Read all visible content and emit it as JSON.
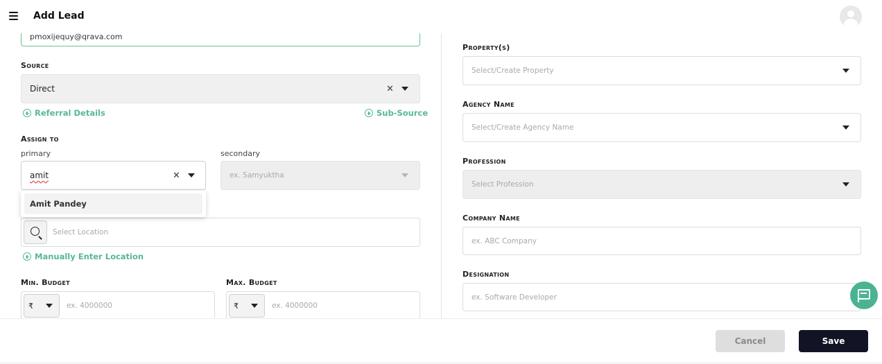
{
  "header": {
    "title": "Add Lead"
  },
  "left": {
    "email_value": "pmoxijequy@qrava.com",
    "source": {
      "label": "Source",
      "value": "Direct"
    },
    "referral_link": "Referral Details",
    "subsource_link": "Sub-Source",
    "assign": {
      "label": "Assign to",
      "primary_label": "primary",
      "secondary_label": "secondary",
      "primary_value": "amit",
      "secondary_placeholder": "ex. Samyuktha",
      "dropdown_option": "Amit Pandey"
    },
    "location": {
      "placeholder": "Select Location",
      "manual_link": "Manually Enter Location"
    },
    "budget": {
      "min_label": "Min. Budget",
      "max_label": "Max. Budget",
      "currency_symbol": "₹",
      "min_placeholder": "ex. 4000000",
      "max_placeholder": "ex. 4000000"
    }
  },
  "right": {
    "property": {
      "label": "Property(s)",
      "placeholder": "Select/Create Property"
    },
    "agency": {
      "label": "Agency Name",
      "placeholder": "Select/Create Agency Name"
    },
    "profession": {
      "label": "Profession",
      "placeholder": "Select Profession"
    },
    "company": {
      "label": "Company Name",
      "placeholder": "ex. ABC Company"
    },
    "designation": {
      "label": "Designation",
      "placeholder": "ex. Software Developer"
    }
  },
  "footer": {
    "cancel_label": "Cancel",
    "save_label": "Save"
  },
  "icons": {
    "menu": "hamburger-icon",
    "avatar": "user-avatar-icon",
    "search": "search-icon",
    "chat": "chat-support-icon"
  },
  "colors": {
    "accent": "#57b894",
    "primary_button": "#121426",
    "fab": "#4bb394"
  }
}
